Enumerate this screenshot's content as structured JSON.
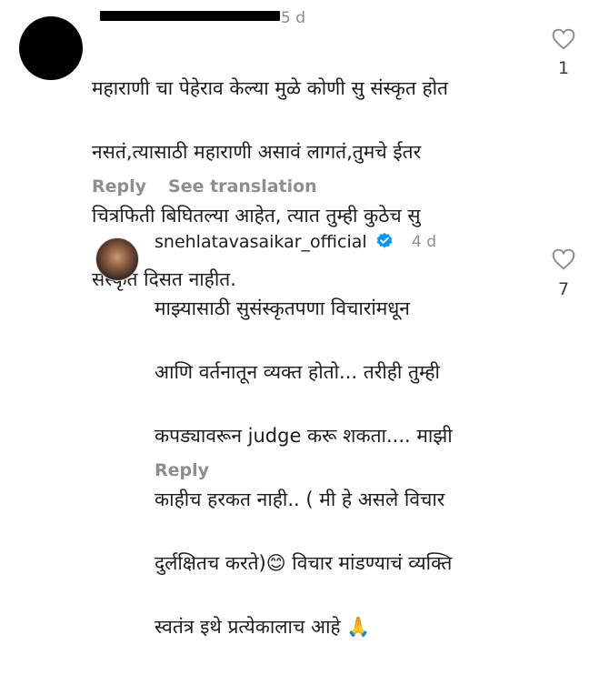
{
  "comment1": {
    "time": "5 d",
    "text_lines": [
      "महाराणी चा पेहेराव केल्या मुळे कोणी सु संस्कृत होत",
      "नसतं,त्यासाठी महाराणी असावं लागतं,तुमचे ईतर",
      "चित्रफिती बिघितल्या आहेत, त्यात तुम्ही कुठेच सु",
      "संस्कृत दिसत नाहीत."
    ],
    "reply_label": "Reply",
    "see_translation_label": "See translation",
    "likes": "1"
  },
  "comment2": {
    "username": "snehlatavasaikar_official",
    "time": "4 d",
    "text_lines": [
      "माझ्यासाठी सुसंस्कृतपणा  विचारांमधून",
      "आणि वर्तनातून व्यक्त होतो... तरीही तुम्ही",
      "कपड्यावरून judge करू शकता.... माझी",
      "काहीच हरकत नाही.. ( मी हे असले विचार",
      "दुर्लक्षितच करते)😊 विचार मांडण्याचं व्यक्ति",
      "स्वतंत्र इथे प्रत्येकालाच आहे 🙏"
    ],
    "reply_label": "Reply",
    "likes": "7"
  },
  "colors": {
    "text": "#1c1c1c",
    "secondary": "#8e8e8e",
    "verified_blue": "#0095f6"
  },
  "icons": [
    "heart-outline-icon",
    "verified-badge-icon"
  ]
}
